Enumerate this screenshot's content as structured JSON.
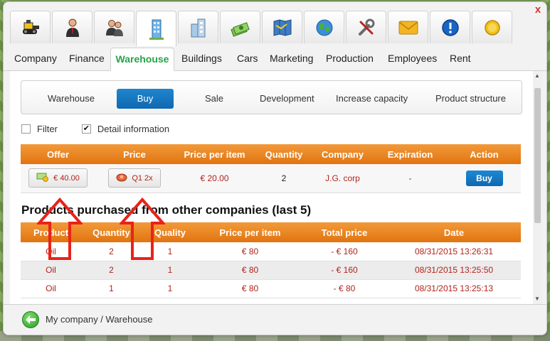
{
  "window": {
    "close_label": "x"
  },
  "icon_tabs": [
    {
      "name": "bulldozer-icon",
      "active": false
    },
    {
      "name": "businessman-icon",
      "active": false
    },
    {
      "name": "people-icon",
      "active": false
    },
    {
      "name": "warehouse-building-icon",
      "active": true
    },
    {
      "name": "buildings-icon",
      "active": false
    },
    {
      "name": "money-stack-icon",
      "active": false
    },
    {
      "name": "map-icon",
      "active": false
    },
    {
      "name": "globe-icon",
      "active": false
    },
    {
      "name": "tools-icon",
      "active": false
    },
    {
      "name": "mail-icon",
      "active": false
    },
    {
      "name": "info-icon",
      "active": false
    },
    {
      "name": "coin-icon",
      "active": false
    }
  ],
  "tabs": [
    {
      "label": "Company"
    },
    {
      "label": "Finance"
    },
    {
      "label": "Warehouse",
      "active": true
    },
    {
      "label": "Buildings"
    },
    {
      "label": "Cars"
    },
    {
      "label": "Marketing"
    },
    {
      "label": "Production"
    },
    {
      "label": "Employees"
    },
    {
      "label": "Rent"
    }
  ],
  "subtabs": [
    {
      "label": "Warehouse"
    },
    {
      "label": "Buy",
      "active": true
    },
    {
      "label": "Sale"
    },
    {
      "label": "Development"
    },
    {
      "label": "Increase capacity"
    },
    {
      "label": "Product structure"
    }
  ],
  "filters": {
    "filter_label": "Filter",
    "filter_checked": false,
    "detail_label": "Detail information",
    "detail_checked": true,
    "check_glyph": "✔"
  },
  "offer_table": {
    "headers": [
      "Offer",
      "Price",
      "Price per item",
      "Quantity",
      "Company",
      "Expiration",
      "Action"
    ],
    "row": {
      "offer": "€ 40.00",
      "price": "Q1 2x",
      "price_per_item": "€ 20.00",
      "quantity": "2",
      "company": "J.G. corp",
      "expiration": "-",
      "action": "Buy"
    }
  },
  "history": {
    "title": "Products purchased from other companies (last 5)",
    "headers": [
      "Product",
      "Quantity",
      "Quality",
      "Price per item",
      "Total price",
      "Date"
    ],
    "rows": [
      {
        "product": "Oil",
        "quantity": "2",
        "quality": "1",
        "price_per_item": "€ 80",
        "total": "- € 160",
        "date": "08/31/2015 13:26:31"
      },
      {
        "product": "Oil",
        "quantity": "2",
        "quality": "1",
        "price_per_item": "€ 80",
        "total": "- € 160",
        "date": "08/31/2015 13:25:50"
      },
      {
        "product": "Oil",
        "quantity": "1",
        "quality": "1",
        "price_per_item": "€ 80",
        "total": "- € 80",
        "date": "08/31/2015 13:25:13"
      }
    ]
  },
  "footer": {
    "breadcrumb": "My company / Warehouse"
  },
  "colors": {
    "accent_green": "#27a34a",
    "header_orange": "#e9841f",
    "button_blue": "#1273bf",
    "value_red": "#b0241b",
    "arrow_red": "#e8231a"
  }
}
